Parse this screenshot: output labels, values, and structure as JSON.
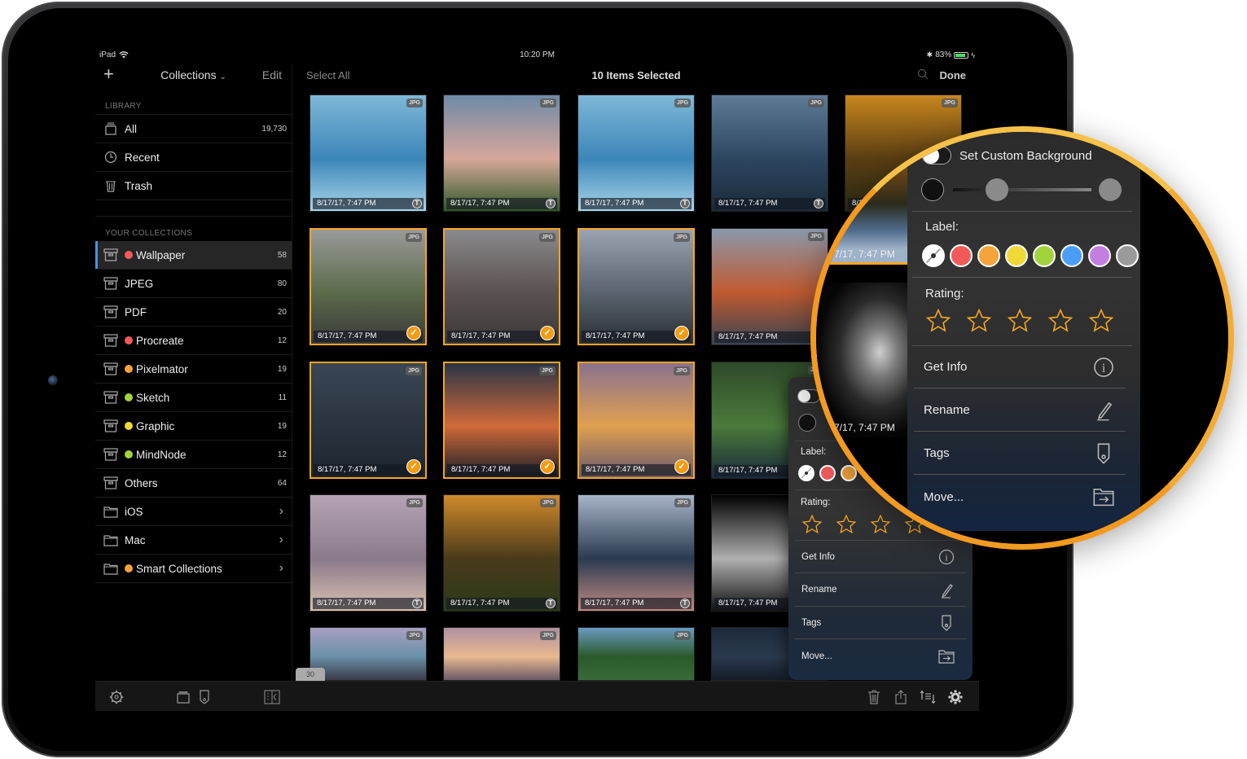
{
  "status_bar": {
    "device": "iPad",
    "time": "10:20 PM",
    "battery": "83%",
    "battery_level": 0.83
  },
  "sidebar": {
    "add_label": "+",
    "title": "Collections",
    "edit_label": "Edit",
    "library_header": "LIBRARY",
    "library": [
      {
        "label": "All",
        "count": "19,730",
        "icon": "stack-icon"
      },
      {
        "label": "Recent",
        "count": "",
        "icon": "clock-icon"
      },
      {
        "label": "Trash",
        "count": "",
        "icon": "trash-icon"
      }
    ],
    "collections_header": "YOUR COLLECTIONS",
    "collections": [
      {
        "label": "Wallpaper",
        "count": "58",
        "dot": "#f25a5a",
        "icon": "box-icon",
        "active": true
      },
      {
        "label": "JPEG",
        "count": "80",
        "dot": "",
        "icon": "box-icon"
      },
      {
        "label": "PDF",
        "count": "20",
        "dot": "",
        "icon": "box-icon"
      },
      {
        "label": "Procreate",
        "count": "12",
        "dot": "#f25a5a",
        "icon": "box-icon"
      },
      {
        "label": "Pixelmator",
        "count": "19",
        "dot": "#f5a33a",
        "icon": "box-icon"
      },
      {
        "label": "Sketch",
        "count": "11",
        "dot": "#a3d33c",
        "icon": "box-icon"
      },
      {
        "label": "Graphic",
        "count": "19",
        "dot": "#f0d838",
        "icon": "box-icon"
      },
      {
        "label": "MindNode",
        "count": "12",
        "dot": "#a3d33c",
        "icon": "box-icon"
      },
      {
        "label": "Others",
        "count": "64",
        "dot": "",
        "icon": "box-icon"
      },
      {
        "label": "iOS",
        "count": "",
        "dot": "",
        "icon": "folder-icon",
        "chevron": true
      },
      {
        "label": "Mac",
        "count": "",
        "dot": "",
        "icon": "folder-icon",
        "chevron": true
      },
      {
        "label": "Smart Collections",
        "count": "",
        "dot": "#f5a33a",
        "icon": "folder-icon",
        "chevron": true
      }
    ]
  },
  "grid_header": {
    "select_all": "Select All",
    "title": "10 Items Selected",
    "done": "Done"
  },
  "thumbnails": [
    {
      "date": "8/17/17, 7:47 PM",
      "type": "JPG",
      "selected": false,
      "colors": [
        "#7fb8d8",
        "#3b86b8",
        "#a8d4e8"
      ]
    },
    {
      "date": "8/17/17, 7:47 PM",
      "type": "JPG",
      "selected": false,
      "colors": [
        "#6f8aa6",
        "#d7a79a",
        "#2f5a2a"
      ]
    },
    {
      "date": "8/17/17, 7:47 PM",
      "type": "JPG",
      "selected": false,
      "colors": [
        "#7fb8d8",
        "#3b86b8",
        "#a8d4e8"
      ]
    },
    {
      "date": "8/17/17, 7:47 PM",
      "type": "JPG",
      "selected": false,
      "colors": [
        "#5e7a96",
        "#2d4660",
        "#1a2a3a"
      ]
    },
    {
      "date": "8/17/17, 7:47 PM",
      "type": "JPG",
      "selected": false,
      "colors": [
        "#c8861e",
        "#5a3e12",
        "#2a2a14"
      ]
    },
    {
      "date": "8/17/17, 7:47 PM",
      "type": "JPG",
      "selected": true,
      "colors": [
        "#9a9a9a",
        "#5b6b4a",
        "#3a3a3a"
      ]
    },
    {
      "date": "8/17/17, 7:47 PM",
      "type": "JPG",
      "selected": true,
      "colors": [
        "#8a8a8c",
        "#5a5250",
        "#3a3838"
      ]
    },
    {
      "date": "8/17/17, 7:47 PM",
      "type": "JPG",
      "selected": true,
      "colors": [
        "#9aa4b0",
        "#5a6470",
        "#2a2e34"
      ]
    },
    {
      "date": "8/17/17, 7:47 PM",
      "type": "JPG",
      "selected": false,
      "colors": [
        "#8a98ac",
        "#c05a30",
        "#3a4452"
      ]
    },
    {
      "date": "8/17/17, 7:47 PM",
      "type": "JPG",
      "selected": false,
      "colors": [
        "#2a2e36",
        "#b8c2c8",
        "#3a6aa0"
      ]
    },
    {
      "date": "8/17/17, 7:47 PM",
      "type": "JPG",
      "selected": true,
      "colors": [
        "#3a4654",
        "#2a3440",
        "#1c242e"
      ]
    },
    {
      "date": "8/17/17, 7:47 PM",
      "type": "JPG",
      "selected": true,
      "colors": [
        "#2a3446",
        "#d06a3a",
        "#1a1e28"
      ]
    },
    {
      "date": "8/17/17, 7:47 PM",
      "type": "JPG",
      "selected": true,
      "colors": [
        "#8a7290",
        "#e0a050",
        "#6a5a6a"
      ]
    },
    {
      "date": "8/17/17, 7:47 PM",
      "type": "JPG",
      "selected": false,
      "colors": [
        "#2e4a2a",
        "#4a7a3a",
        "#1a2a3a"
      ]
    },
    {
      "date": "8/17/17, 7:47 PM",
      "type": "JPG",
      "selected": false,
      "colors": [
        "#b6a4b4",
        "#8a7a8a",
        "#d8c0b0"
      ]
    },
    {
      "date": "8/17/17, 7:47 PM",
      "type": "JPG",
      "selected": false,
      "colors": [
        "#d08a2a",
        "#4a3a1a",
        "#2a3a1a"
      ]
    },
    {
      "date": "8/17/17, 7:47 PM",
      "type": "JPG",
      "selected": false,
      "colors": [
        "#a8b4c8",
        "#2a3a50",
        "#c08a80"
      ]
    },
    {
      "date": "8/17/17, 7:47 PM",
      "type": "",
      "selected": false,
      "colors": [
        "#000000",
        "#b0b0b0",
        "#111111"
      ]
    },
    {
      "date": "",
      "type": "JPG",
      "selected": false,
      "colors": [
        "#a8a0c0",
        "#6a90a8",
        "#3a3a4a"
      ]
    },
    {
      "date": "",
      "type": "JPG",
      "selected": false,
      "colors": [
        "#b090a0",
        "#e8b890",
        "#6a5a6a"
      ]
    },
    {
      "date": "",
      "type": "JPG",
      "selected": false,
      "colors": [
        "#6a9ac0",
        "#2a5a2a",
        "#3a6a3a"
      ]
    },
    {
      "date": "",
      "type": "",
      "selected": false,
      "colors": [
        "#1e2a3a",
        "#2a3a4e",
        "#141c28"
      ]
    }
  ],
  "scroll_badge": "30",
  "popover": {
    "custom_background_label": "Set Custom Background",
    "custom_background_on": false,
    "brightness_value": 0.2,
    "label_header": "Label:",
    "label_colors": [
      "none",
      "#f25a5a",
      "#f5a33a",
      "#f0d838",
      "#a3d33c",
      "#4a9ef5",
      "#c47ee0",
      "#9a9a9a"
    ],
    "rating_header": "Rating:",
    "rating": 0,
    "rating_max": 5,
    "menu": [
      {
        "label": "Get Info",
        "icon": "info-icon"
      },
      {
        "label": "Rename",
        "icon": "pencil-icon"
      },
      {
        "label": "Tags",
        "icon": "tag-icon"
      },
      {
        "label": "Move...",
        "icon": "folder-move-icon"
      }
    ],
    "partial_date": "7/17, 7:47 PM"
  },
  "colors": {
    "accent": "#f5a623",
    "sidebar_active_bar": "#4a90e2",
    "magnifier_ring": "#f39a21"
  }
}
